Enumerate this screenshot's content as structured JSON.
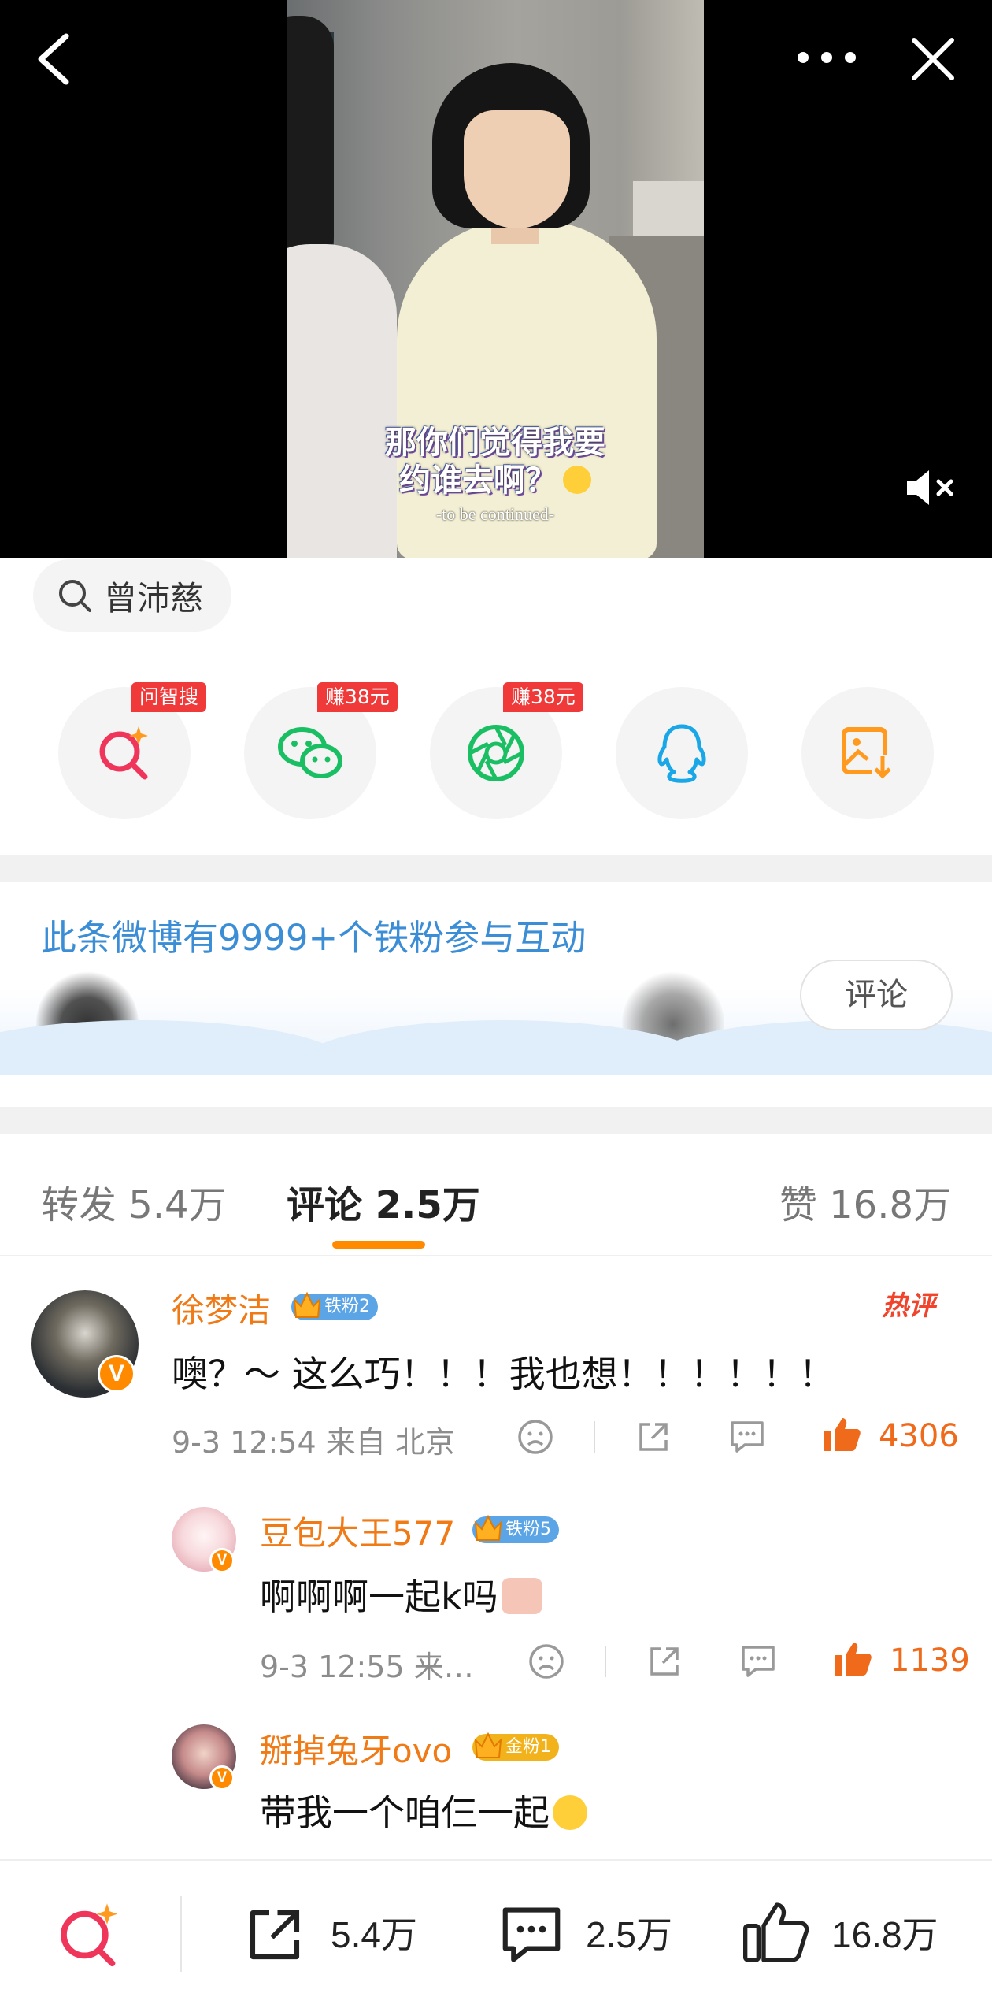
{
  "video": {
    "subtitle_line1": "那你们觉得我要",
    "subtitle_line2": "约谁去啊？",
    "subtitle_tbc": "-to be continued-",
    "icons": [
      "back-arrow-icon",
      "more-dots-icon",
      "close-x-icon",
      "mute-speaker-icon"
    ]
  },
  "search_chip": {
    "label": "曾沛慈",
    "icon": "search-icon"
  },
  "share": [
    {
      "name": "ai-search",
      "badge": "问智搜",
      "icon": "ai-search-icon",
      "color": "#f0355a"
    },
    {
      "name": "wechat",
      "badge": "赚38元",
      "icon": "wechat-icon",
      "color": "#1bbf63"
    },
    {
      "name": "moments",
      "badge": "赚38元",
      "icon": "moments-icon",
      "color": "#1bbf63"
    },
    {
      "name": "qq",
      "badge": "",
      "icon": "qq-icon",
      "color": "#1aa7e8"
    },
    {
      "name": "save-image",
      "badge": "",
      "icon": "save-image-icon",
      "color": "#ff9a1f"
    }
  ],
  "fans_banner": {
    "title": "此条微博有9999+个铁粉参与互动",
    "comment_button": "评论"
  },
  "tabs": {
    "repost": "转发 5.4万",
    "comments": "评论 2.5万",
    "likes": "赞 16.8万"
  },
  "comments": [
    {
      "user": "徐梦洁",
      "fan_badge": "铁粉2",
      "hot_label": "热评",
      "text": "噢？～ 这么巧！！！我也想！！！！！！",
      "time": "9-3 12:54",
      "location": "来自 北京",
      "likes": "4306"
    }
  ],
  "replies": [
    {
      "user": "豆包大王577",
      "fan_badge": "铁粉5",
      "text": "啊啊啊一起k吗",
      "time": "9-3 12:55",
      "location": "来…",
      "likes": "1139"
    },
    {
      "user": "掰掉兔牙ovo",
      "fan_badge": "金粉1",
      "text": "带我一个咱仨一起"
    }
  ],
  "bottom_bar": {
    "repost": "5.4万",
    "comment": "2.5万",
    "like": "16.8万"
  },
  "colors": {
    "accent_orange": "#ff8a00",
    "username_orange": "#ef7a16",
    "link_blue": "#3b8ed6",
    "badge_red": "#f03a3a",
    "hot_red": "#f0452c"
  }
}
